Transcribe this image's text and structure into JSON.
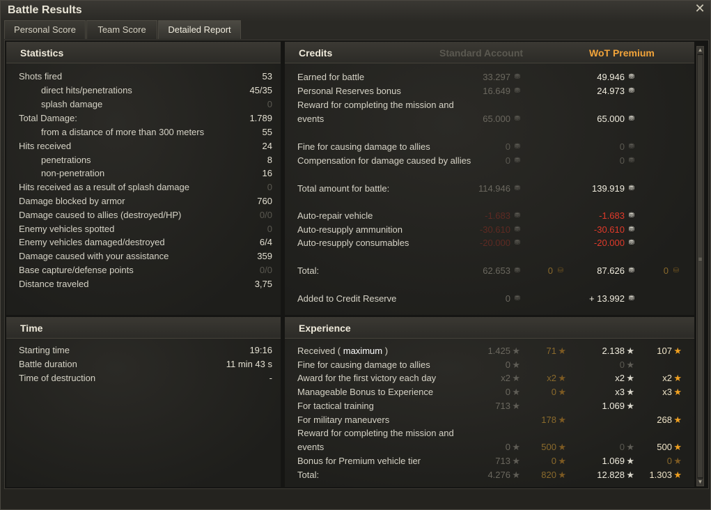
{
  "window": {
    "title": "Battle Results",
    "close_icon": "close-icon"
  },
  "tabs": [
    {
      "label": "Personal Score"
    },
    {
      "label": "Team Score"
    },
    {
      "label": "Detailed Report",
      "active": true
    }
  ],
  "statistics": {
    "title": "Statistics",
    "rows": [
      {
        "label": "Shots fired",
        "value": "53",
        "indent": false,
        "dim": false
      },
      {
        "label": "direct hits/penetrations",
        "value": "45/35",
        "indent": true,
        "dim": false
      },
      {
        "label": "splash damage",
        "value": "0",
        "indent": true,
        "dim": true
      },
      {
        "label": "Total Damage:",
        "value": "1.789",
        "indent": false,
        "dim": false
      },
      {
        "label": "from a distance of more than 300 meters",
        "value": "55",
        "indent": true,
        "dim": false
      },
      {
        "label": "Hits received",
        "value": "24",
        "indent": false,
        "dim": false
      },
      {
        "label": "penetrations",
        "value": "8",
        "indent": true,
        "dim": false
      },
      {
        "label": "non-penetration",
        "value": "16",
        "indent": true,
        "dim": false
      },
      {
        "label": "Hits received as a result of splash damage",
        "value": "0",
        "indent": false,
        "dim": true
      },
      {
        "label": "Damage blocked by armor",
        "value": "760",
        "indent": false,
        "dim": false
      },
      {
        "label": "Damage caused to allies (destroyed/HP)",
        "value": "0/0",
        "indent": false,
        "dim": true
      },
      {
        "label": "Enemy vehicles spotted",
        "value": "0",
        "indent": false,
        "dim": true
      },
      {
        "label": "Enemy vehicles damaged/destroyed",
        "value": "6/4",
        "indent": false,
        "dim": false
      },
      {
        "label": "Damage caused with your assistance",
        "value": "359",
        "indent": false,
        "dim": false
      },
      {
        "label": "Base capture/defense points",
        "value": "0/0",
        "indent": false,
        "dim": true
      },
      {
        "label": "Distance traveled",
        "value": "3,75",
        "indent": false,
        "dim": false
      }
    ]
  },
  "time": {
    "title": "Time",
    "rows": [
      {
        "label": "Starting time",
        "value": "19:16"
      },
      {
        "label": "Battle duration",
        "value": "11 min 43 s"
      },
      {
        "label": "Time of destruction",
        "value": "-"
      }
    ]
  },
  "credits": {
    "title": "Credits",
    "standard_header": "Standard Account",
    "premium_header": "WoT Premium",
    "rows": [
      {
        "label": "Earned for battle",
        "std": "33.297",
        "prem": "49.946"
      },
      {
        "label": "Personal Reserves bonus",
        "std": "16.649",
        "prem": "24.973"
      },
      {
        "label": "Reward for completing the mission and",
        "label2": "events",
        "std": "65.000",
        "prem": "65.000"
      },
      {
        "label": "Fine for causing damage to allies",
        "std": "0",
        "prem": "0",
        "dim": true
      },
      {
        "label": "Compensation for damage caused by allies",
        "std": "0",
        "prem": "0",
        "dim": true
      },
      {
        "label": "Total amount for battle:",
        "std": "114.946",
        "prem": "139.919"
      },
      {
        "label": "Auto-repair vehicle",
        "std": "-1.683",
        "prem": "-1.683",
        "red": true
      },
      {
        "label": "Auto-resupply ammunition",
        "std": "-30.610",
        "prem": "-30.610",
        "red": true
      },
      {
        "label": "Auto-resupply consumables",
        "std": "-20.000",
        "prem": "-20.000",
        "red": true
      },
      {
        "label": "Total:",
        "std": "62.653",
        "std_gold": "0",
        "prem": "87.626",
        "prem_gold": "0"
      },
      {
        "label": "Added to Credit Reserve",
        "std": "0",
        "prem": "+ 13.992"
      }
    ]
  },
  "experience": {
    "title": "Experience",
    "rows": [
      {
        "label": "Received ( ",
        "label_bold": "maximum",
        "label_end": " )",
        "std": "1.425",
        "std_free": "71",
        "prem": "2.138",
        "prem_free": "107"
      },
      {
        "label": "Fine for causing damage to allies",
        "std": "0",
        "prem": "0"
      },
      {
        "label": "Award for the first victory each day",
        "std": "x2",
        "std_free": "x2",
        "prem": "x2",
        "prem_free": "x2"
      },
      {
        "label": "Manageable Bonus to Experience",
        "std": "0",
        "std_free": "0",
        "prem": "x3",
        "prem_free": "x3"
      },
      {
        "label": "For tactical training",
        "std": "713",
        "prem": "1.069"
      },
      {
        "label": "For military maneuvers",
        "std_free": "178",
        "prem_free": "268"
      },
      {
        "label": "Reward for completing the mission and",
        "label2": "events",
        "std": "0",
        "std_free": "500",
        "prem": "0",
        "prem_free": "500"
      },
      {
        "label": "Bonus for Premium vehicle tier",
        "std": "713",
        "std_free": "0",
        "prem": "1.069",
        "prem_free": "0"
      },
      {
        "label": "Total:",
        "std": "4.276",
        "std_free": "820",
        "prem": "12.828",
        "prem_free": "1.303"
      }
    ]
  },
  "icons": {
    "credit": "credit-coin-icon",
    "gold": "gold-coin-icon",
    "xp": "xp-star-icon",
    "free_xp": "free-xp-star-icon"
  },
  "colors": {
    "premium": "#f2a43a",
    "negative": "#e03a2a",
    "free_xp": "#f0a020"
  }
}
